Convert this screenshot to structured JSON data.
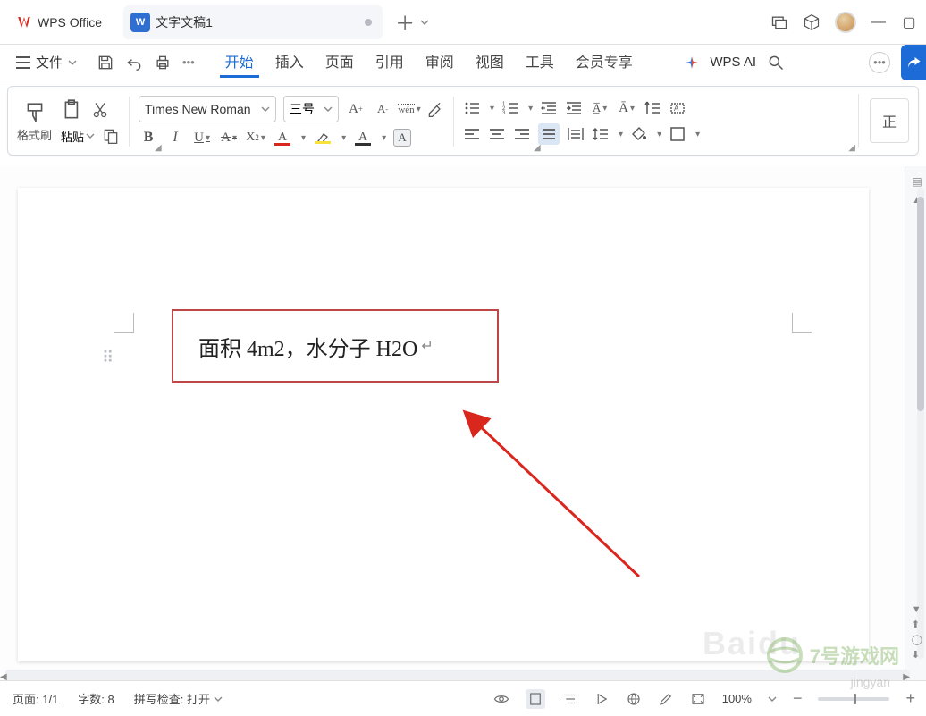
{
  "app": {
    "name": "WPS Office",
    "doc_icon_letter": "W"
  },
  "tabs": {
    "doc_title": "文字文稿1"
  },
  "menubar": {
    "file": "文件",
    "tabs": [
      "开始",
      "插入",
      "页面",
      "引用",
      "审阅",
      "视图",
      "工具",
      "会员专享"
    ],
    "active_tab": "开始",
    "ai_label": "WPS AI"
  },
  "ribbon": {
    "format_painter": "格式刷",
    "paste": "粘贴",
    "font_name": "Times New Roman",
    "font_size": "三号",
    "style_preview": "正"
  },
  "document": {
    "text": "面积 4m2，水分子 H2O",
    "paragraph_mark": "↵"
  },
  "statusbar": {
    "page": "页面: 1/1",
    "words": "字数: 8",
    "spell": "拼写检查: 打开",
    "zoom": "100%"
  },
  "icons": {
    "plus": "＋"
  },
  "watermarks": {
    "site": "7号游戏网",
    "sub": "jingyan",
    "baidu": "Baidu"
  }
}
